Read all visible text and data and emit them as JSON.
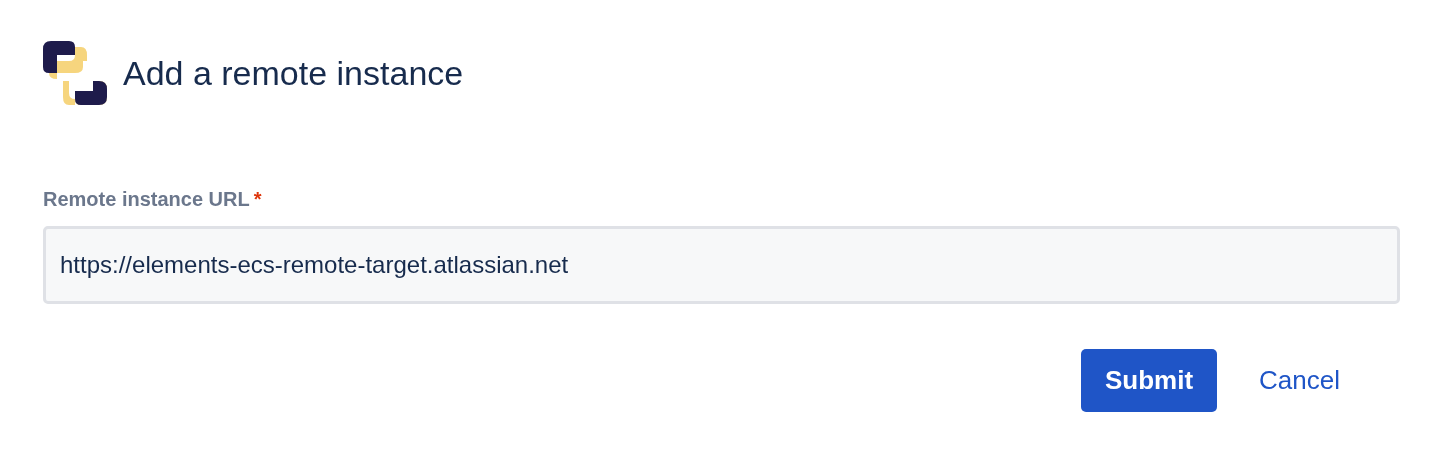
{
  "title": "Add a remote instance",
  "field": {
    "label": "Remote instance URL",
    "required_mark": "*",
    "value": "https://elements-ecs-remote-target.atlassian.net"
  },
  "buttons": [
    {
      "label": "Submit",
      "kind": "primary"
    },
    {
      "label": "Cancel",
      "kind": "link"
    }
  ]
}
